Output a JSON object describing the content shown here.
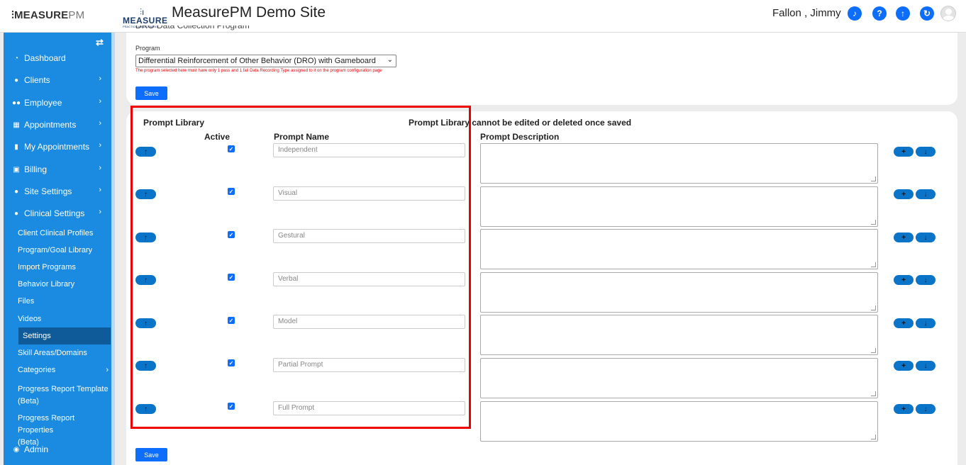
{
  "header": {
    "left_brand": "MEASURE",
    "left_brand_suffix": "PM",
    "logo_word": "MEASURE",
    "logo_sub": "PRACTICE MANAGEMENT",
    "site_title": "MeasurePM Demo Site",
    "user_name": "Fallon , Jimmy",
    "icons": [
      "bell-icon",
      "help-icon",
      "upload-icon",
      "refresh-icon",
      "avatar"
    ]
  },
  "sidebar": {
    "items": [
      {
        "label": "Dashboard",
        "icon": "dashboard-icon"
      },
      {
        "label": "Clients",
        "icon": "user-icon"
      },
      {
        "label": "Employee",
        "icon": "users-icon"
      },
      {
        "label": "Appointments",
        "icon": "calendar-icon"
      },
      {
        "label": "My Appointments",
        "icon": "book-icon"
      },
      {
        "label": "Billing",
        "icon": "money-icon"
      },
      {
        "label": "Site Settings",
        "icon": "user-icon"
      },
      {
        "label": "Clinical Settings",
        "icon": "user-icon"
      }
    ],
    "subitems": [
      "Client Clinical Profiles",
      "Program/Goal Library",
      "Import Programs",
      "Behavior Library",
      "Files",
      "Videos",
      "Settings",
      "Skill Areas/Domains",
      "Categories"
    ],
    "progress_template": [
      "Progress Report Template",
      "(Beta)"
    ],
    "progress_properties": [
      "Progress Report Properties",
      "(Beta)"
    ],
    "admin": "Admin"
  },
  "top_panel": {
    "cut_title": "DRO Data Collection Program",
    "program_label": "Program",
    "program_value": "Differential Reinforcement of Other Behavior (DRO) with Gameboard",
    "program_note": "The program selected here must have only 1 pass and 1 fail Data Recording Type assigned to it on the program configuration page",
    "save_label": "Save"
  },
  "prompt_library": {
    "title": "Prompt Library",
    "warning": "Prompt Library cannot be edited or deleted once saved",
    "col_active": "Active",
    "col_name": "Prompt Name",
    "col_description": "Prompt Description",
    "rows": [
      {
        "name": "Independent",
        "active": true
      },
      {
        "name": "Visual",
        "active": true
      },
      {
        "name": "Gestural",
        "active": true
      },
      {
        "name": "Verbal",
        "active": true
      },
      {
        "name": "Model",
        "active": true
      },
      {
        "name": "Partial Prompt",
        "active": true
      },
      {
        "name": "Full Prompt",
        "active": true
      }
    ],
    "save_label": "Save"
  }
}
